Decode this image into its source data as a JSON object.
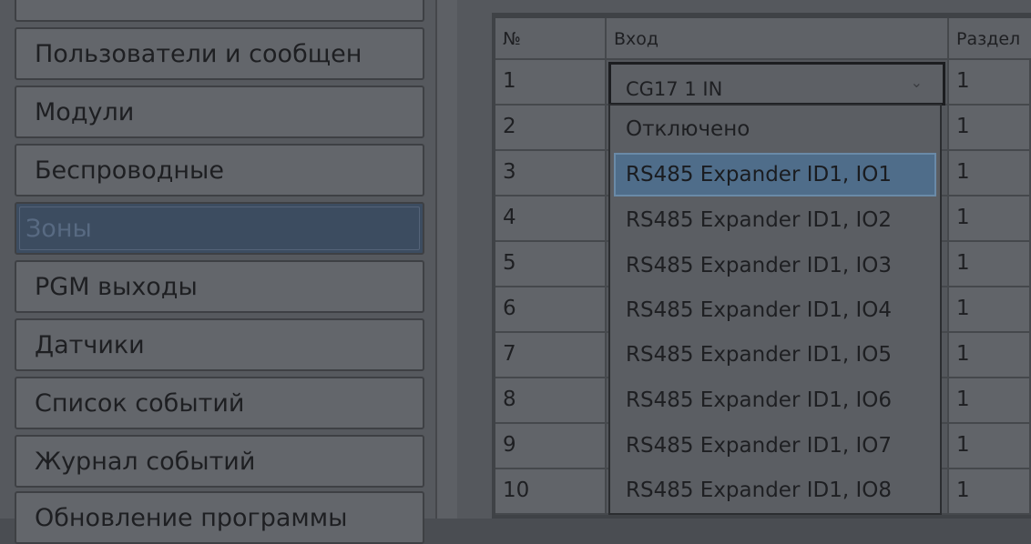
{
  "sidebar": {
    "items": [
      {
        "label": "Пользователи и сообщен",
        "active": false
      },
      {
        "label": "Модули",
        "active": false
      },
      {
        "label": "Беспроводные",
        "active": false
      },
      {
        "label": "Зоны",
        "active": true
      },
      {
        "label": "PGM выходы",
        "active": false
      },
      {
        "label": "Датчики",
        "active": false
      },
      {
        "label": "Список событий",
        "active": false
      },
      {
        "label": "Журнал событий",
        "active": false
      },
      {
        "label": "Обновление программы",
        "active": false
      }
    ]
  },
  "table": {
    "columns": [
      "№",
      "Вход",
      "Раздел"
    ],
    "rows": [
      {
        "num": "1",
        "input": "CG17 1 IN",
        "section": "1"
      },
      {
        "num": "2",
        "input": "",
        "section": "1"
      },
      {
        "num": "3",
        "input": "",
        "section": "1"
      },
      {
        "num": "4",
        "input": "",
        "section": "1"
      },
      {
        "num": "5",
        "input": "",
        "section": "1"
      },
      {
        "num": "6",
        "input": "",
        "section": "1"
      },
      {
        "num": "7",
        "input": "",
        "section": "1"
      },
      {
        "num": "8",
        "input": "",
        "section": "1"
      },
      {
        "num": "9",
        "input": "",
        "section": "1"
      },
      {
        "num": "10",
        "input": "",
        "section": "1"
      }
    ]
  },
  "combo": {
    "value": "CG17 1 IN",
    "arrow_icon": "chevron-down-icon"
  },
  "dropdown": {
    "options": [
      "Отключено",
      "RS485 Expander ID1, IO1",
      "RS485 Expander ID1, IO2",
      "RS485 Expander ID1, IO3",
      "RS485 Expander ID1, IO4",
      "RS485 Expander ID1, IO5",
      "RS485 Expander ID1, IO6",
      "RS485 Expander ID1, IO7",
      "RS485 Expander ID1, IO8"
    ],
    "highlighted": "RS485 Expander ID1, IO1"
  },
  "colors": {
    "active_nav": "#3c4c60",
    "highlight": "#4f6d8a"
  }
}
